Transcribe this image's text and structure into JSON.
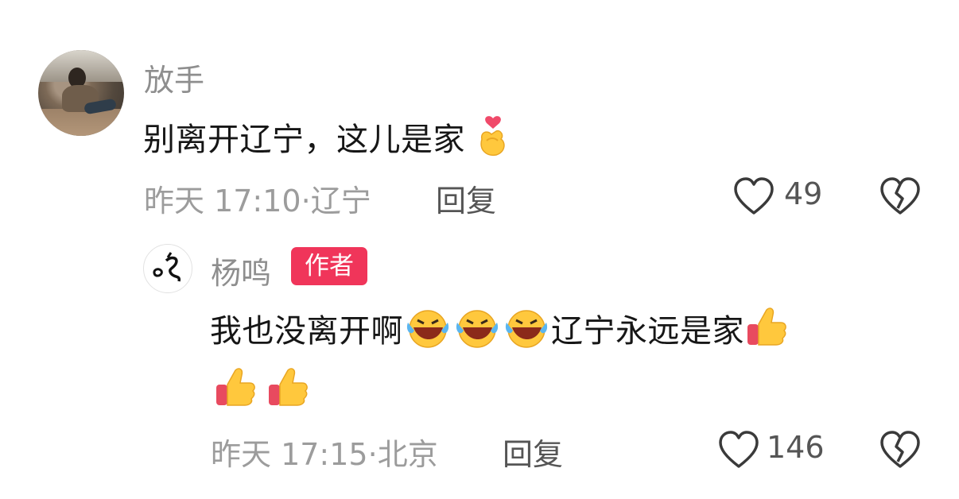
{
  "comment": {
    "username": "放手",
    "text": "别离开辽宁，这儿是家",
    "emoji": "finger-heart-emoji",
    "time": "昨天 17:10",
    "location": "辽宁",
    "reply_label": "回复",
    "like_count": "49"
  },
  "reply": {
    "username": "杨鸣",
    "badge": "作者",
    "text_part1": "我也没离开啊",
    "text_part2": "辽宁永远是家",
    "emojis_mid": [
      "rofl-emoji",
      "rofl-emoji",
      "rofl-emoji"
    ],
    "emojis_end": [
      "thumbs-up-emoji",
      "thumbs-up-emoji",
      "thumbs-up-emoji"
    ],
    "time": "昨天 17:15",
    "location": "北京",
    "reply_label": "回复",
    "like_count": "146"
  },
  "colors": {
    "badge": "#f0355a",
    "text_primary": "#161616",
    "text_secondary": "#8e8e8e"
  }
}
